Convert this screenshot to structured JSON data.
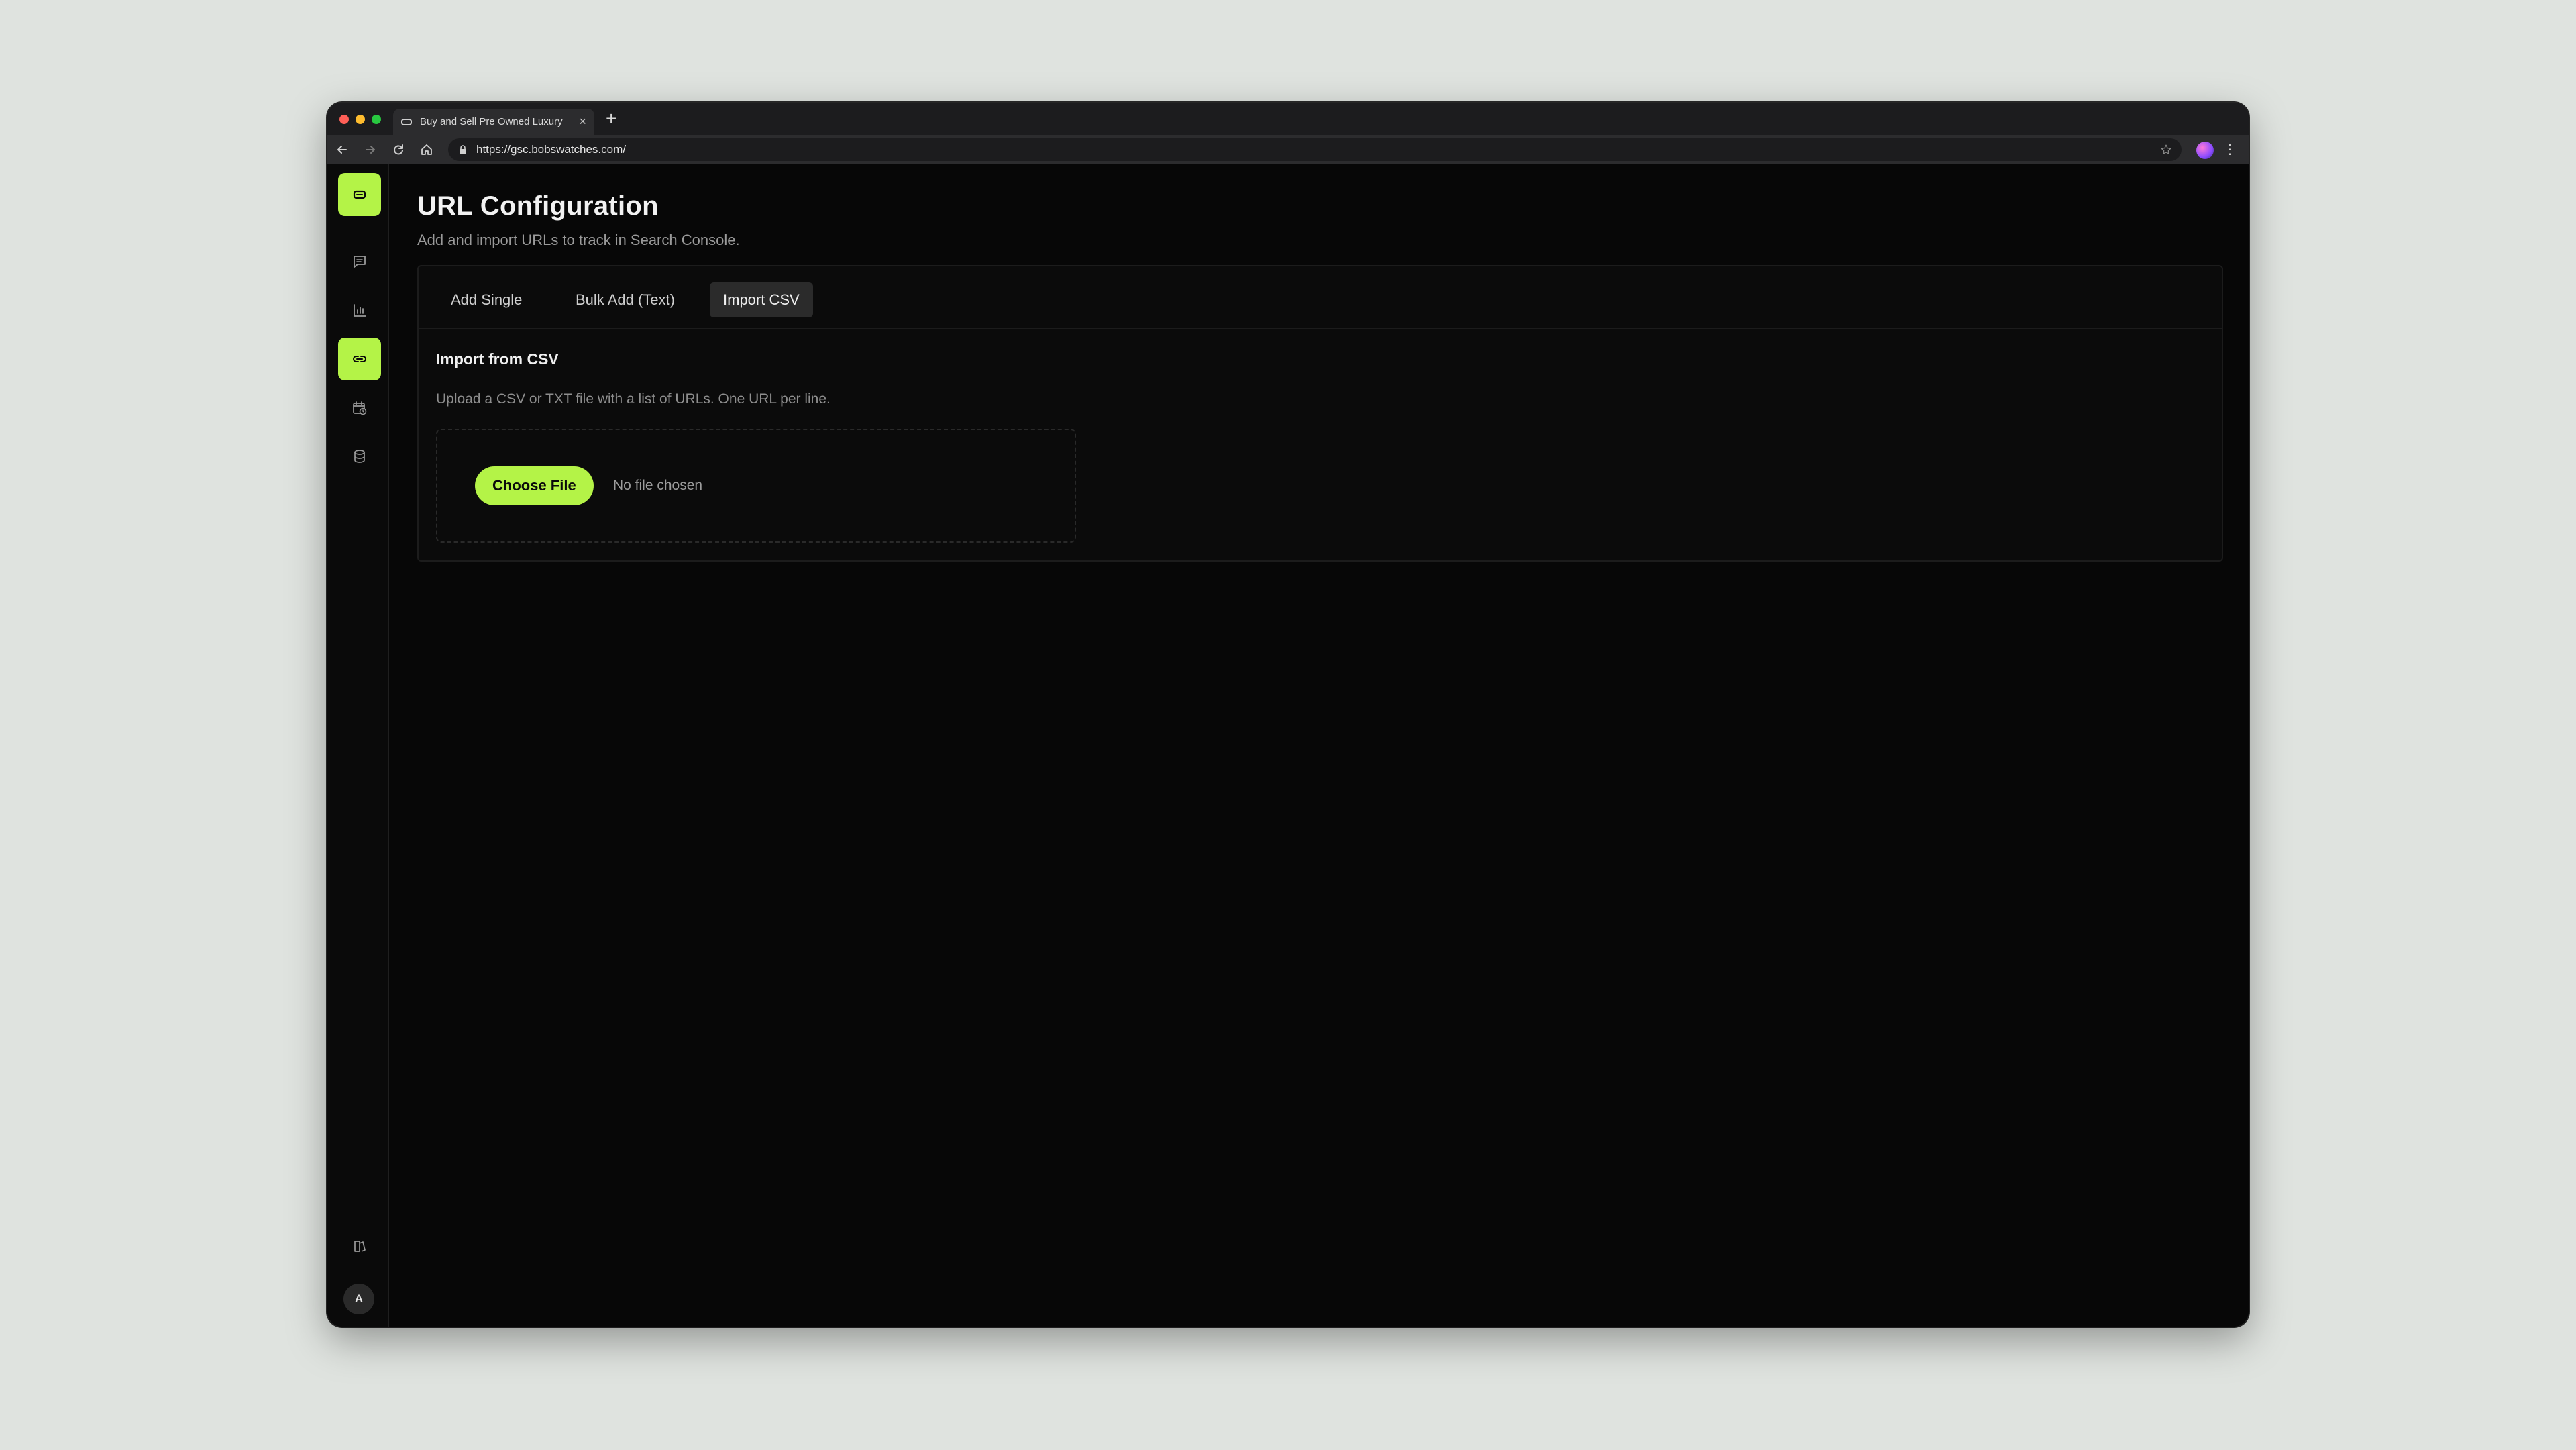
{
  "browser": {
    "tab_title": "Buy and Sell Pre Owned Luxury",
    "url": "https://gsc.bobswatches.com/",
    "new_tab_label": "+",
    "tab_close_label": "×",
    "menu_label": "⋮"
  },
  "sidebar": {
    "items": [
      {
        "name": "logo",
        "icon": "logo-icon",
        "active": false
      },
      {
        "name": "messages",
        "icon": "message-icon",
        "active": false
      },
      {
        "name": "analytics",
        "icon": "bar-chart-icon",
        "active": false
      },
      {
        "name": "urls",
        "icon": "link-icon",
        "active": true
      },
      {
        "name": "schedule",
        "icon": "calendar-clock-icon",
        "active": false
      },
      {
        "name": "database",
        "icon": "database-icon",
        "active": false
      }
    ],
    "bottom_icon": "docs-icon",
    "avatar_initial": "A"
  },
  "page": {
    "title": "URL Configuration",
    "subtitle": "Add and import URLs to track in Search Console."
  },
  "tabs": [
    {
      "label": "Add Single",
      "active": false
    },
    {
      "label": "Bulk Add (Text)",
      "active": false
    },
    {
      "label": "Import CSV",
      "active": true
    }
  ],
  "import": {
    "title": "Import from CSV",
    "description": "Upload a CSV or TXT file with a list of URLs. One URL per line.",
    "choose_button": "Choose File",
    "file_status": "No file chosen"
  },
  "colors": {
    "accent": "#b4f347",
    "background": "#070707"
  }
}
